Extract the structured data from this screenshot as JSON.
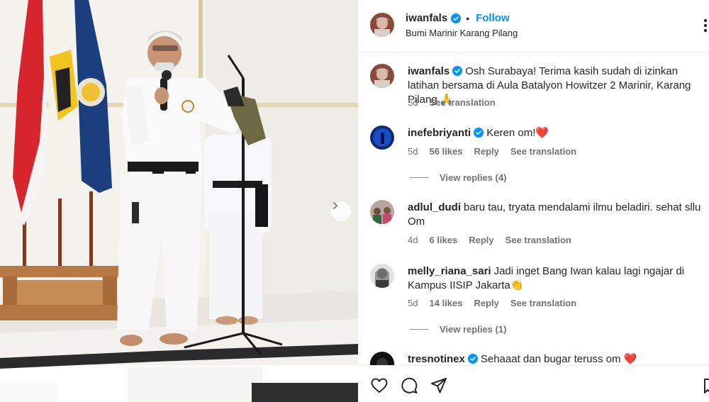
{
  "post": {
    "author": "iwanfals",
    "follow_label": "Follow",
    "separator": "•",
    "location": "Bumi Marinir Karang Pilang",
    "more_icon": "more-options-icon"
  },
  "media": {
    "next_icon": "chevron-right-icon"
  },
  "caption": {
    "username": "iwanfals",
    "text": "Osh Surabaya! Terima kasih sudah di izinkan latihan bersama di Aula Batalyon Howitzer 2 Marinir, Karang Pilang 🙏",
    "time": "5d",
    "see_translation": "See translation"
  },
  "comments": [
    {
      "username": "inefebriyanti",
      "verified": true,
      "text": "Keren om!❤️",
      "time": "5d",
      "likes": "56 likes",
      "reply": "Reply",
      "see_translation": "See translation",
      "view_replies": "View replies (4)"
    },
    {
      "username": "adlul_dudi",
      "verified": false,
      "text": "baru tau, tryata mendalami ilmu beladiri. sehat sllu Om",
      "time": "4d",
      "likes": "6 likes",
      "reply": "Reply",
      "see_translation": "See translation"
    },
    {
      "username": "melly_riana_sari",
      "verified": false,
      "text": "Jadi inget Bang Iwan kalau lagi ngajar di Kampus IISIP Jakarta👏",
      "time": "5d",
      "likes": "14 likes",
      "reply": "Reply",
      "see_translation": "See translation",
      "view_replies": "View replies (1)"
    },
    {
      "username": "tresnotinex",
      "verified": true,
      "text": "Sehaaat dan bugar teruss om ❤️"
    }
  ],
  "action_bar": {
    "icons": [
      "heart-icon",
      "comment-icon",
      "share-icon",
      "bookmark-icon"
    ]
  },
  "colors": {
    "accent": "#0095f6",
    "verified": "#0095f6",
    "secondary_text": "#737373"
  }
}
